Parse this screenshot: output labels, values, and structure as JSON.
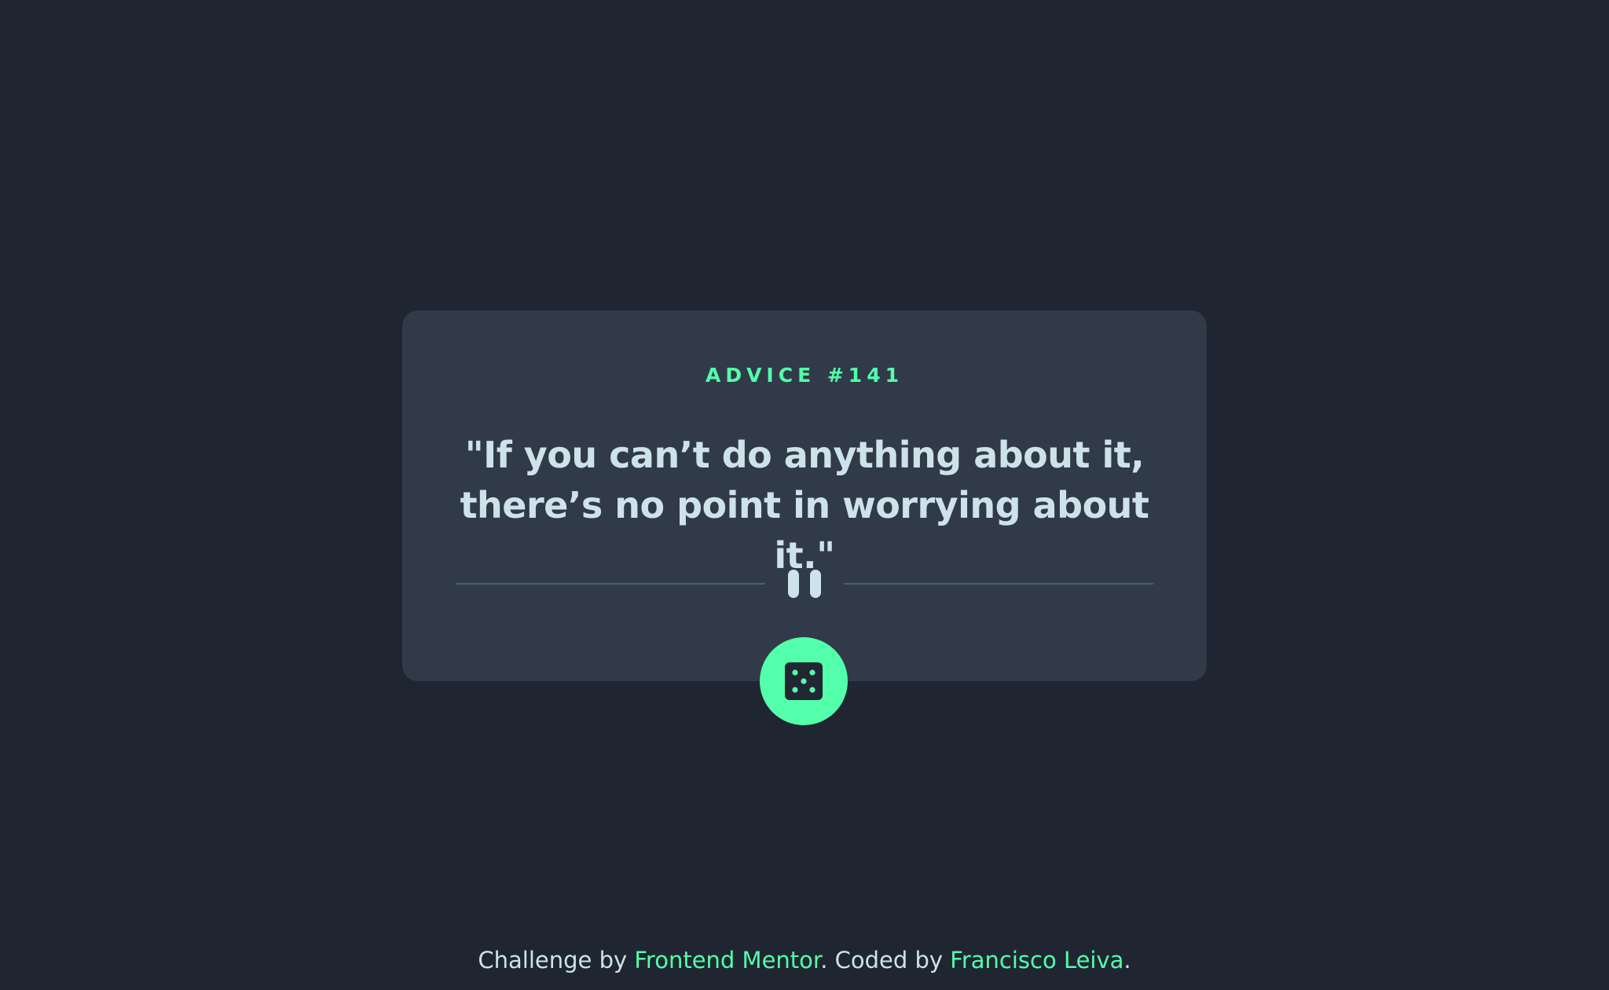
{
  "advice": {
    "id_label": "ADVICE #141",
    "text": "\"If you can’t do anything about it, there’s no point in worrying about it.\""
  },
  "button": {
    "icon": "dice-icon",
    "aria_label": "Generate new advice"
  },
  "divider": {
    "icon": "pause-icon"
  },
  "footer": {
    "prefix": "Challenge by ",
    "challenge_link": "Frontend Mentor",
    "middle": ". Coded by ",
    "author_link": "Francisco Leiva",
    "suffix": "."
  },
  "colors": {
    "background": "#1f2632",
    "card": "#313a48",
    "accent": "#53ffaa",
    "text": "#cee3e9",
    "divider": "#4f5d74"
  }
}
